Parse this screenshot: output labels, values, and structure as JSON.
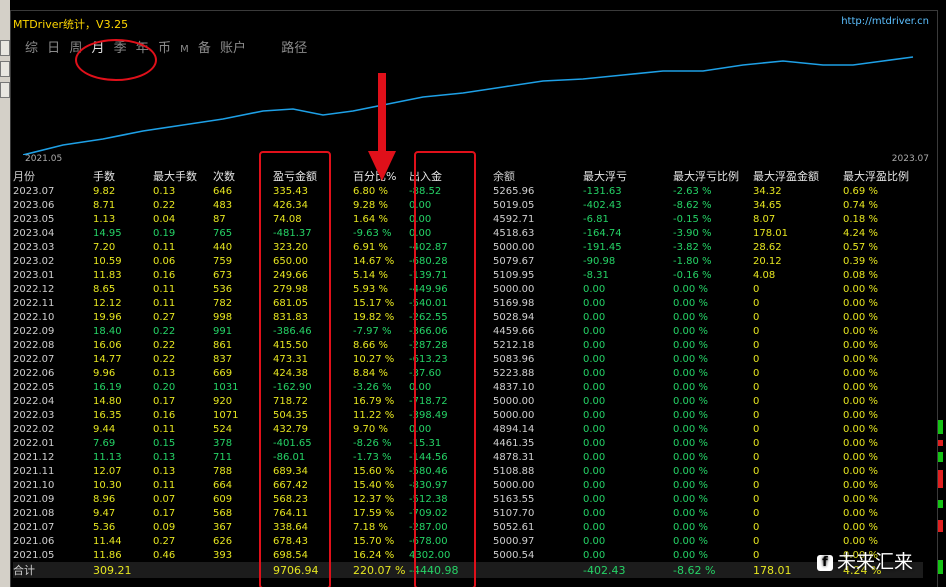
{
  "app": {
    "title": "MTDriver统计，V3.25",
    "url": "http://mtdriver.cn"
  },
  "tabs": [
    {
      "label": "综"
    },
    {
      "label": "日"
    },
    {
      "label": "周"
    },
    {
      "label": "月",
      "active": true
    },
    {
      "label": "季"
    },
    {
      "label": "年"
    },
    {
      "label": "币"
    },
    {
      "label": "M"
    },
    {
      "label": "备"
    },
    {
      "label": "账户"
    },
    {
      "label": "路径"
    }
  ],
  "equity": {
    "start_label": "2021.05",
    "end_label": "2023.07",
    "line_color": "#1ea0e6"
  },
  "columns": [
    "月份",
    "手数",
    "最大手数",
    "次数",
    "盈亏金额",
    "百分比%",
    "出入金",
    "余额",
    "最大浮亏",
    "最大浮亏比例",
    "最大浮盈金额",
    "最大浮盈比例"
  ],
  "rows": [
    [
      "2023.07",
      "9.82",
      "0.13",
      "646",
      "335.43",
      "6.80 %",
      "-88.52",
      "5265.96",
      "-131.63",
      "-2.63 %",
      "34.32",
      "0.69 %"
    ],
    [
      "2023.06",
      "8.71",
      "0.22",
      "483",
      "426.34",
      "9.28 %",
      "0.00",
      "5019.05",
      "-402.43",
      "-8.62 %",
      "34.65",
      "0.74 %"
    ],
    [
      "2023.05",
      "1.13",
      "0.04",
      "87",
      "74.08",
      "1.64 %",
      "0.00",
      "4592.71",
      "-6.81",
      "-0.15 %",
      "8.07",
      "0.18 %"
    ],
    [
      "2023.04",
      "14.95",
      "0.19",
      "765",
      "-481.37",
      "-9.63 %",
      "0.00",
      "4518.63",
      "-164.74",
      "-3.90 %",
      "178.01",
      "4.24 %"
    ],
    [
      "2023.03",
      "7.20",
      "0.11",
      "440",
      "323.20",
      "6.91 %",
      "-402.87",
      "5000.00",
      "-191.45",
      "-3.82 %",
      "28.62",
      "0.57 %"
    ],
    [
      "2023.02",
      "10.59",
      "0.06",
      "759",
      "650.00",
      "14.67 %",
      "-680.28",
      "5079.67",
      "-90.98",
      "-1.80 %",
      "20.12",
      "0.39 %"
    ],
    [
      "2023.01",
      "11.83",
      "0.16",
      "673",
      "249.66",
      "5.14 %",
      "-139.71",
      "5109.95",
      "-8.31",
      "-0.16 %",
      "4.08",
      "0.08 %"
    ],
    [
      "2022.12",
      "8.65",
      "0.11",
      "536",
      "279.98",
      "5.93 %",
      "-449.96",
      "5000.00",
      "0.00",
      "0.00 %",
      "0",
      "0.00 %"
    ],
    [
      "2022.11",
      "12.12",
      "0.11",
      "782",
      "681.05",
      "15.17 %",
      "-540.01",
      "5169.98",
      "0.00",
      "0.00 %",
      "0",
      "0.00 %"
    ],
    [
      "2022.10",
      "19.96",
      "0.27",
      "998",
      "831.83",
      "19.82 %",
      "-262.55",
      "5028.94",
      "0.00",
      "0.00 %",
      "0",
      "0.00 %"
    ],
    [
      "2022.09",
      "18.40",
      "0.22",
      "991",
      "-386.46",
      "-7.97 %",
      "-366.06",
      "4459.66",
      "0.00",
      "0.00 %",
      "0",
      "0.00 %"
    ],
    [
      "2022.08",
      "16.06",
      "0.22",
      "861",
      "415.50",
      "8.66 %",
      "-287.28",
      "5212.18",
      "0.00",
      "0.00 %",
      "0",
      "0.00 %"
    ],
    [
      "2022.07",
      "14.77",
      "0.22",
      "837",
      "473.31",
      "10.27 %",
      "-613.23",
      "5083.96",
      "0.00",
      "0.00 %",
      "0",
      "0.00 %"
    ],
    [
      "2022.06",
      "9.96",
      "0.13",
      "669",
      "424.38",
      "8.84 %",
      "-37.60",
      "5223.88",
      "0.00",
      "0.00 %",
      "0",
      "0.00 %"
    ],
    [
      "2022.05",
      "16.19",
      "0.20",
      "1031",
      "-162.90",
      "-3.26 %",
      "0.00",
      "4837.10",
      "0.00",
      "0.00 %",
      "0",
      "0.00 %"
    ],
    [
      "2022.04",
      "14.80",
      "0.17",
      "920",
      "718.72",
      "16.79 %",
      "-718.72",
      "5000.00",
      "0.00",
      "0.00 %",
      "0",
      "0.00 %"
    ],
    [
      "2022.03",
      "16.35",
      "0.16",
      "1071",
      "504.35",
      "11.22 %",
      "-398.49",
      "5000.00",
      "0.00",
      "0.00 %",
      "0",
      "0.00 %"
    ],
    [
      "2022.02",
      "9.44",
      "0.11",
      "524",
      "432.79",
      "9.70 %",
      "0.00",
      "4894.14",
      "0.00",
      "0.00 %",
      "0",
      "0.00 %"
    ],
    [
      "2022.01",
      "7.69",
      "0.15",
      "378",
      "-401.65",
      "-8.26 %",
      "-15.31",
      "4461.35",
      "0.00",
      "0.00 %",
      "0",
      "0.00 %"
    ],
    [
      "2021.12",
      "11.13",
      "0.13",
      "711",
      "-86.01",
      "-1.73 %",
      "-144.56",
      "4878.31",
      "0.00",
      "0.00 %",
      "0",
      "0.00 %"
    ],
    [
      "2021.11",
      "12.07",
      "0.13",
      "788",
      "689.34",
      "15.60 %",
      "-580.46",
      "5108.88",
      "0.00",
      "0.00 %",
      "0",
      "0.00 %"
    ],
    [
      "2021.10",
      "10.30",
      "0.11",
      "664",
      "667.42",
      "15.40 %",
      "-830.97",
      "5000.00",
      "0.00",
      "0.00 %",
      "0",
      "0.00 %"
    ],
    [
      "2021.09",
      "8.96",
      "0.07",
      "609",
      "568.23",
      "12.37 %",
      "-512.38",
      "5163.55",
      "0.00",
      "0.00 %",
      "0",
      "0.00 %"
    ],
    [
      "2021.08",
      "9.47",
      "0.17",
      "568",
      "764.11",
      "17.59 %",
      "-709.02",
      "5107.70",
      "0.00",
      "0.00 %",
      "0",
      "0.00 %"
    ],
    [
      "2021.07",
      "5.36",
      "0.09",
      "367",
      "338.64",
      "7.18 %",
      "-287.00",
      "5052.61",
      "0.00",
      "0.00 %",
      "0",
      "0.00 %"
    ],
    [
      "2021.06",
      "11.44",
      "0.27",
      "626",
      "678.43",
      "15.70 %",
      "-678.00",
      "5000.97",
      "0.00",
      "0.00 %",
      "0",
      "0.00 %"
    ],
    [
      "2021.05",
      "11.86",
      "0.46",
      "393",
      "698.54",
      "16.24 %",
      "4302.00",
      "5000.54",
      "0.00",
      "0.00 %",
      "0",
      "0.00 %"
    ]
  ],
  "total": [
    "合计",
    "309.21",
    "",
    "",
    "9706.94",
    "220.07 %",
    "-4440.98",
    "",
    "-402.43",
    "-8.62 %",
    "178.01",
    "4.24 %"
  ],
  "watermark": "未来汇来",
  "watermark_logo": "f",
  "colors": {
    "accent_title": "#ffd700",
    "positive": "#e6e620",
    "negative": "#25d366",
    "annotation": "#e0101a"
  }
}
